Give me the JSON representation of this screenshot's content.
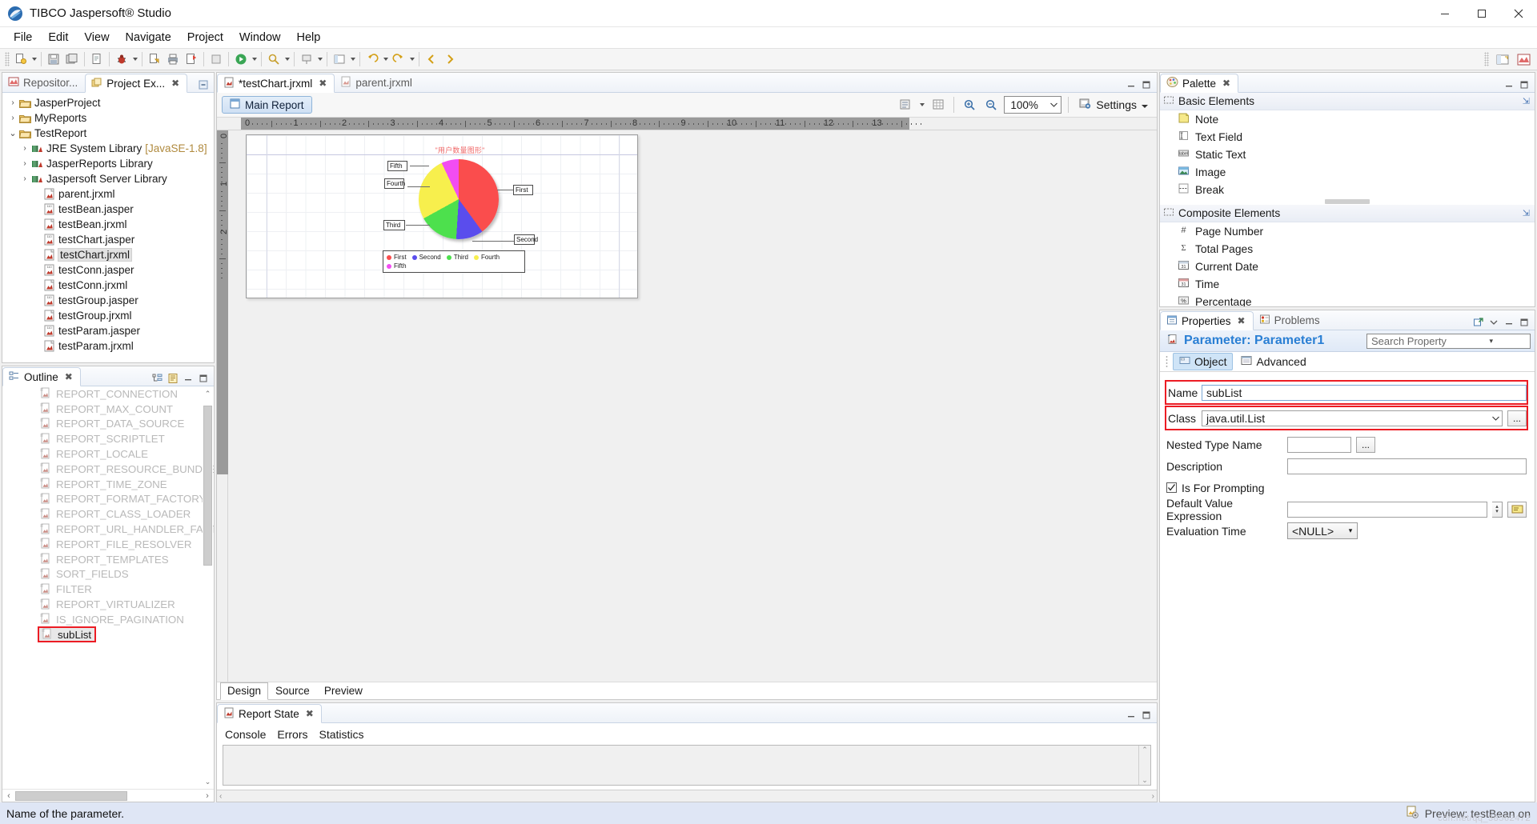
{
  "window": {
    "title": "TIBCO Jaspersoft® Studio",
    "controls": {
      "minimize": "minimize-icon",
      "maximize": "maximize-icon",
      "close": "close-icon"
    }
  },
  "menubar": [
    "File",
    "Edit",
    "View",
    "Navigate",
    "Project",
    "Window",
    "Help"
  ],
  "project_explorer": {
    "tabs": [
      {
        "label": "Repositor...",
        "active": false,
        "icon": "repository-icon"
      },
      {
        "label": "Project Ex...",
        "active": true,
        "icon": "project-explorer-icon"
      }
    ],
    "close_glyph": "✖",
    "collapse_all": "collapse-all-icon",
    "tree": [
      {
        "label": "JasperProject",
        "arrow": "›",
        "indent": 0,
        "icon": "folder-icon",
        "selected": false
      },
      {
        "label": "MyReports",
        "arrow": "›",
        "indent": 0,
        "icon": "folder-icon",
        "selected": false
      },
      {
        "label": "TestReport",
        "arrow": "⌄",
        "indent": 0,
        "icon": "folder-icon",
        "selected": false
      },
      {
        "label": "JRE System Library",
        "suffix": "[JavaSE-1.8]",
        "arrow": "›",
        "indent": 1,
        "icon": "library-icon",
        "selected": false
      },
      {
        "label": "JasperReports Library",
        "arrow": "›",
        "indent": 1,
        "icon": "library-icon",
        "selected": false
      },
      {
        "label": "Jaspersoft Server Library",
        "arrow": "›",
        "indent": 1,
        "icon": "library-icon",
        "selected": false
      },
      {
        "label": "parent.jrxml",
        "arrow": "",
        "indent": 2,
        "icon": "jrxml-icon",
        "selected": false
      },
      {
        "label": "testBean.jasper",
        "arrow": "",
        "indent": 2,
        "icon": "jasper-icon",
        "selected": false
      },
      {
        "label": "testBean.jrxml",
        "arrow": "",
        "indent": 2,
        "icon": "jrxml-icon",
        "selected": false
      },
      {
        "label": "testChart.jasper",
        "arrow": "",
        "indent": 2,
        "icon": "jasper-icon",
        "selected": false
      },
      {
        "label": "testChart.jrxml",
        "arrow": "",
        "indent": 2,
        "icon": "jrxml-icon",
        "selected": true
      },
      {
        "label": "testConn.jasper",
        "arrow": "",
        "indent": 2,
        "icon": "jasper-icon",
        "selected": false
      },
      {
        "label": "testConn.jrxml",
        "arrow": "",
        "indent": 2,
        "icon": "jrxml-icon",
        "selected": false
      },
      {
        "label": "testGroup.jasper",
        "arrow": "",
        "indent": 2,
        "icon": "jasper-icon",
        "selected": false
      },
      {
        "label": "testGroup.jrxml",
        "arrow": "",
        "indent": 2,
        "icon": "jrxml-icon",
        "selected": false
      },
      {
        "label": "testParam.jasper",
        "arrow": "",
        "indent": 2,
        "icon": "jasper-icon",
        "selected": false
      },
      {
        "label": "testParam.jrxml",
        "arrow": "",
        "indent": 2,
        "icon": "jrxml-icon",
        "selected": false
      }
    ]
  },
  "outline": {
    "tab_label": "Outline",
    "close_glyph": "✖",
    "tools": [
      "tree-view-icon",
      "list-view-icon",
      "minimize-icon",
      "maximize-icon"
    ],
    "items": [
      {
        "label": "REPORT_CONNECTION",
        "highlighted": false
      },
      {
        "label": "REPORT_MAX_COUNT",
        "highlighted": false
      },
      {
        "label": "REPORT_DATA_SOURCE",
        "highlighted": false
      },
      {
        "label": "REPORT_SCRIPTLET",
        "highlighted": false
      },
      {
        "label": "REPORT_LOCALE",
        "highlighted": false
      },
      {
        "label": "REPORT_RESOURCE_BUNDLE",
        "highlighted": false
      },
      {
        "label": "REPORT_TIME_ZONE",
        "highlighted": false
      },
      {
        "label": "REPORT_FORMAT_FACTORY",
        "highlighted": false
      },
      {
        "label": "REPORT_CLASS_LOADER",
        "highlighted": false
      },
      {
        "label": "REPORT_URL_HANDLER_FACT",
        "highlighted": false
      },
      {
        "label": "REPORT_FILE_RESOLVER",
        "highlighted": false
      },
      {
        "label": "REPORT_TEMPLATES",
        "highlighted": false
      },
      {
        "label": "SORT_FIELDS",
        "highlighted": false
      },
      {
        "label": "FILTER",
        "highlighted": false
      },
      {
        "label": "REPORT_VIRTUALIZER",
        "highlighted": false
      },
      {
        "label": "IS_IGNORE_PAGINATION",
        "highlighted": false
      },
      {
        "label": "subList",
        "highlighted": true
      }
    ]
  },
  "editor": {
    "tabs": [
      {
        "label": "*testChart.jrxml",
        "active": true,
        "icon": "jrxml-icon",
        "close": "✖"
      },
      {
        "label": "parent.jrxml",
        "active": false,
        "icon": "jrxml-icon",
        "close": ""
      }
    ],
    "main_report_button": "Main Report",
    "zoom_value": "100%",
    "settings_label": "Settings",
    "toolbar_icons": [
      "report-outline-icon",
      "grid-icon",
      "zoom-in-icon",
      "zoom-out-icon",
      "settings-icon"
    ],
    "ruler_h_numbers": [
      "0",
      "1",
      "2",
      "3",
      "4",
      "5",
      "6",
      "7",
      "8",
      "9",
      "10",
      "11",
      "12",
      "13"
    ],
    "ruler_v_numbers": [
      "0",
      "1",
      "2"
    ],
    "bottom_tabs": [
      {
        "label": "Design",
        "active": true
      },
      {
        "label": "Source",
        "active": false
      },
      {
        "label": "Preview",
        "active": false
      }
    ]
  },
  "chart_data": {
    "type": "pie",
    "title": "\"用户数量图形\"",
    "categories": [
      "First",
      "Second",
      "Third",
      "Fourth",
      "Fifth"
    ],
    "values": [
      40,
      11,
      16,
      26,
      7
    ],
    "colors": [
      "#fa4d4d",
      "#5a4ded",
      "#4de04d",
      "#f7ef4d",
      "#f24df2"
    ],
    "legend_position": "bottom",
    "callout_labels": [
      "First",
      "Second",
      "Third",
      "Fourth",
      "Fifth"
    ],
    "legend_entries": [
      {
        "label": "First",
        "color": "#fa4d4d"
      },
      {
        "label": "Second",
        "color": "#5a4ded"
      },
      {
        "label": "Third",
        "color": "#4de04d"
      },
      {
        "label": "Fourth",
        "color": "#f7ef4d"
      },
      {
        "label": "Fifth",
        "color": "#f24df2"
      }
    ],
    "title_color": "#f06a6a"
  },
  "report_state": {
    "tab_label": "Report State",
    "close_glyph": "✖",
    "tabs": [
      "Console",
      "Errors",
      "Statistics"
    ],
    "body_text": ""
  },
  "palette": {
    "tab_label": "Palette",
    "close_glyph": "✖",
    "groups": [
      {
        "title": "Basic Elements",
        "items": [
          {
            "label": "Note",
            "icon": "note-icon"
          },
          {
            "label": "Text Field",
            "icon": "text-field-icon"
          },
          {
            "label": "Static Text",
            "icon": "static-text-icon"
          },
          {
            "label": "Image",
            "icon": "image-icon"
          },
          {
            "label": "Break",
            "icon": "break-icon"
          }
        ]
      },
      {
        "title": "Composite Elements",
        "items": [
          {
            "label": "Page Number",
            "icon": "page-number-icon"
          },
          {
            "label": "Total Pages",
            "icon": "total-pages-icon"
          },
          {
            "label": "Current Date",
            "icon": "calendar-icon"
          },
          {
            "label": "Time",
            "icon": "clock-icon"
          },
          {
            "label": "Percentage",
            "icon": "percent-icon"
          }
        ]
      }
    ]
  },
  "properties": {
    "tabs": [
      {
        "label": "Properties",
        "active": true,
        "icon": "properties-icon",
        "close": "✖"
      },
      {
        "label": "Problems",
        "active": false,
        "icon": "problems-icon",
        "close": ""
      }
    ],
    "header_title": "Parameter: Parameter1",
    "header_icon": "parameter-icon",
    "search_placeholder": "Search Property",
    "object_tabs": [
      {
        "label": "Object",
        "active": true,
        "icon": "object-icon"
      },
      {
        "label": "Advanced",
        "active": false,
        "icon": "advanced-icon"
      }
    ],
    "fields": {
      "name_label": "Name",
      "name_value": "subList",
      "class_label": "Class",
      "class_value": "java.util.List",
      "nested_label": "Nested Type Name",
      "nested_value": "",
      "nested_button": "...",
      "description_label": "Description",
      "description_value": "",
      "prompting_label": "Is For Prompting",
      "prompting_checked": true,
      "default_label": "Default Value Expression",
      "default_value": "",
      "evaluation_label": "Evaluation Time",
      "evaluation_value": "<NULL>"
    },
    "class_button": "..."
  },
  "statusbar": {
    "message": "Name of the parameter.",
    "right_text": "Preview: testBean on",
    "right_icon": "preview-icon",
    "watermark": "cdn.net/qq_38562472"
  }
}
